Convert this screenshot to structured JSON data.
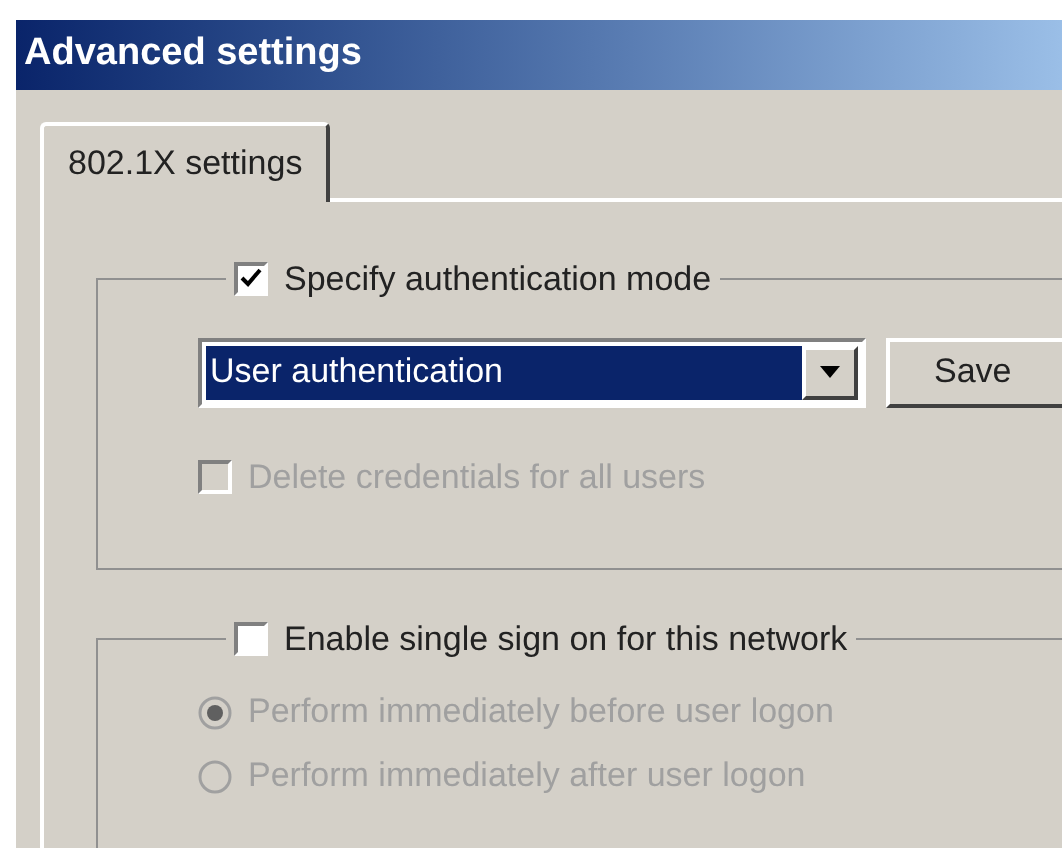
{
  "window": {
    "title": "Advanced settings"
  },
  "tabs": [
    {
      "label": "802.1X settings",
      "selected": true
    }
  ],
  "auth_group": {
    "label": "Specify authentication mode",
    "checked": true,
    "mode_dropdown": {
      "value": "User authentication"
    },
    "save_button": "Save",
    "delete_credentials": {
      "label": "Delete credentials for all users",
      "checked": false,
      "disabled": true
    }
  },
  "sso_group": {
    "label": "Enable single sign on for this network",
    "checked": false,
    "options": [
      {
        "label": "Perform immediately before user logon",
        "selected": true,
        "disabled": true
      },
      {
        "label": "Perform immediately after user logon",
        "selected": false,
        "disabled": true
      }
    ]
  }
}
